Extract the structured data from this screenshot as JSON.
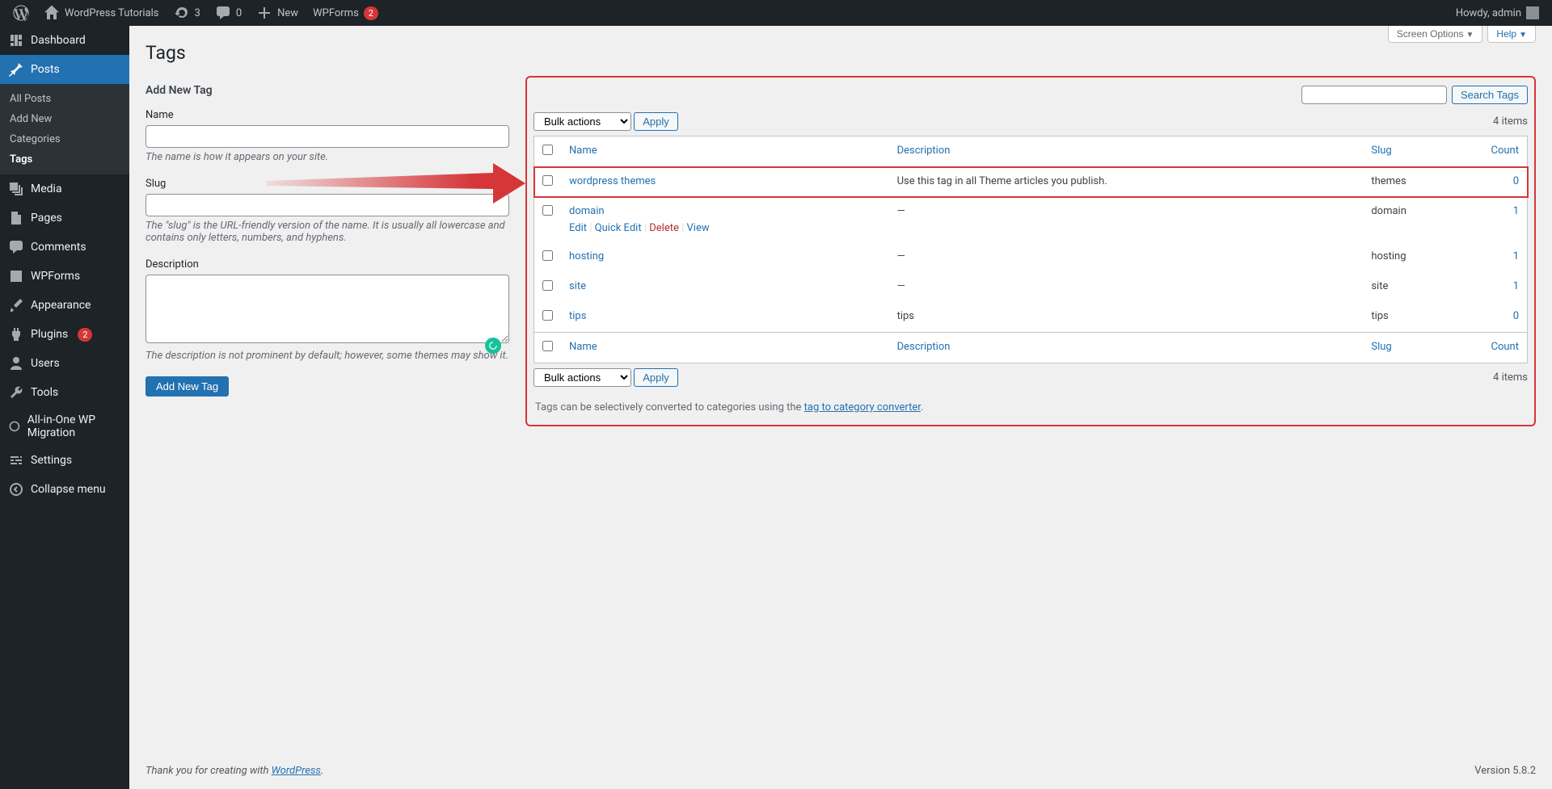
{
  "adminbar": {
    "site_name": "WordPress Tutorials",
    "updates": "3",
    "comments": "0",
    "new": "New",
    "wpforms": "WPForms",
    "wpforms_count": "2",
    "howdy": "Howdy, admin"
  },
  "menu": {
    "dashboard": "Dashboard",
    "posts": "Posts",
    "posts_sub": {
      "all": "All Posts",
      "add": "Add New",
      "categories": "Categories",
      "tags": "Tags"
    },
    "media": "Media",
    "pages": "Pages",
    "comments": "Comments",
    "wpforms": "WPForms",
    "appearance": "Appearance",
    "plugins": "Plugins",
    "plugins_count": "2",
    "users": "Users",
    "tools": "Tools",
    "migration": "All-in-One WP Migration",
    "settings": "Settings",
    "collapse": "Collapse menu"
  },
  "screen_meta": {
    "options": "Screen Options",
    "help": "Help"
  },
  "page": {
    "title": "Tags"
  },
  "form": {
    "heading": "Add New Tag",
    "name_label": "Name",
    "name_desc": "The name is how it appears on your site.",
    "slug_label": "Slug",
    "slug_desc": "The \"slug\" is the URL-friendly version of the name. It is usually all lowercase and contains only letters, numbers, and hyphens.",
    "desc_label": "Description",
    "desc_desc": "The description is not prominent by default; however, some themes may show it.",
    "submit": "Add New Tag"
  },
  "list": {
    "search_btn": "Search Tags",
    "bulk_label": "Bulk actions",
    "apply": "Apply",
    "items_count": "4 items",
    "cols": {
      "name": "Name",
      "description": "Description",
      "slug": "Slug",
      "count": "Count"
    },
    "rows": [
      {
        "name": "wordpress themes",
        "description": "Use this tag in all Theme articles you publish.",
        "slug": "themes",
        "count": "0",
        "highlighted": true
      },
      {
        "name": "domain",
        "description": "—",
        "slug": "domain",
        "count": "1",
        "actions": true
      },
      {
        "name": "hosting",
        "description": "—",
        "slug": "hosting",
        "count": "1"
      },
      {
        "name": "site",
        "description": "—",
        "slug": "site",
        "count": "1"
      },
      {
        "name": "tips",
        "description": "tips",
        "slug": "tips",
        "count": "0"
      }
    ],
    "actions": {
      "edit": "Edit",
      "quick": "Quick Edit",
      "delete": "Delete",
      "view": "View"
    },
    "convert_pre": "Tags can be selectively converted to categories using the ",
    "convert_link": "tag to category converter"
  },
  "footer": {
    "thank_pre": "Thank you for creating with ",
    "wp": "WordPress",
    "version": "Version 5.8.2"
  }
}
